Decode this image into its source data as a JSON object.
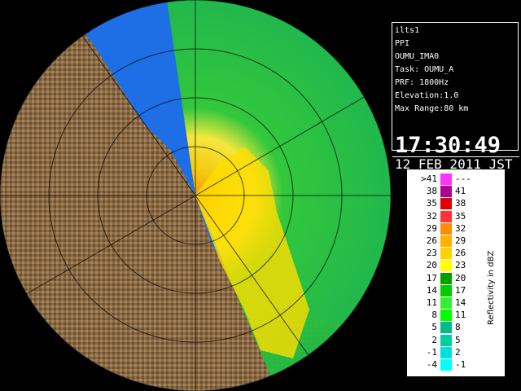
{
  "info": {
    "lines": [
      "ilts1",
      "PPI",
      "OUMU_IMA0",
      "Task: OUMU_A",
      "PRF: 1800Hz",
      "Elevation:1.0",
      "Max Range:80 km"
    ],
    "time": "17:30:49",
    "date": "12 FEB 2011 JST"
  },
  "legend": {
    "title": "Reflectivity in dBZ",
    "rows": [
      {
        "lo": ">41",
        "hi": "---",
        "color": "#ff33ff"
      },
      {
        "lo": "38",
        "hi": "41",
        "color": "#b00090"
      },
      {
        "lo": "35",
        "hi": "38",
        "color": "#e00000"
      },
      {
        "lo": "32",
        "hi": "35",
        "color": "#ff3333"
      },
      {
        "lo": "29",
        "hi": "32",
        "color": "#ff8c00"
      },
      {
        "lo": "26",
        "hi": "29",
        "color": "#ffb000"
      },
      {
        "lo": "23",
        "hi": "26",
        "color": "#ffd200"
      },
      {
        "lo": "20",
        "hi": "23",
        "color": "#ffff00"
      },
      {
        "lo": "17",
        "hi": "20",
        "color": "#00a000"
      },
      {
        "lo": "14",
        "hi": "17",
        "color": "#00cc00"
      },
      {
        "lo": "11",
        "hi": "14",
        "color": "#33ee33"
      },
      {
        "lo": "8",
        "hi": "11",
        "color": "#00ff00"
      },
      {
        "lo": "5",
        "hi": "8",
        "color": "#00bb88"
      },
      {
        "lo": "2",
        "hi": "5",
        "color": "#00d0a0"
      },
      {
        "lo": "-1",
        "hi": "2",
        "color": "#00e0e0"
      },
      {
        "lo": "-4",
        "hi": "-1",
        "color": "#00ffff"
      }
    ]
  },
  "colors": {
    "ocean": "#1e6fe6",
    "land": "#8a6a45",
    "echo_green": "#33cc33",
    "echo_yellow": "#ffdd00"
  }
}
